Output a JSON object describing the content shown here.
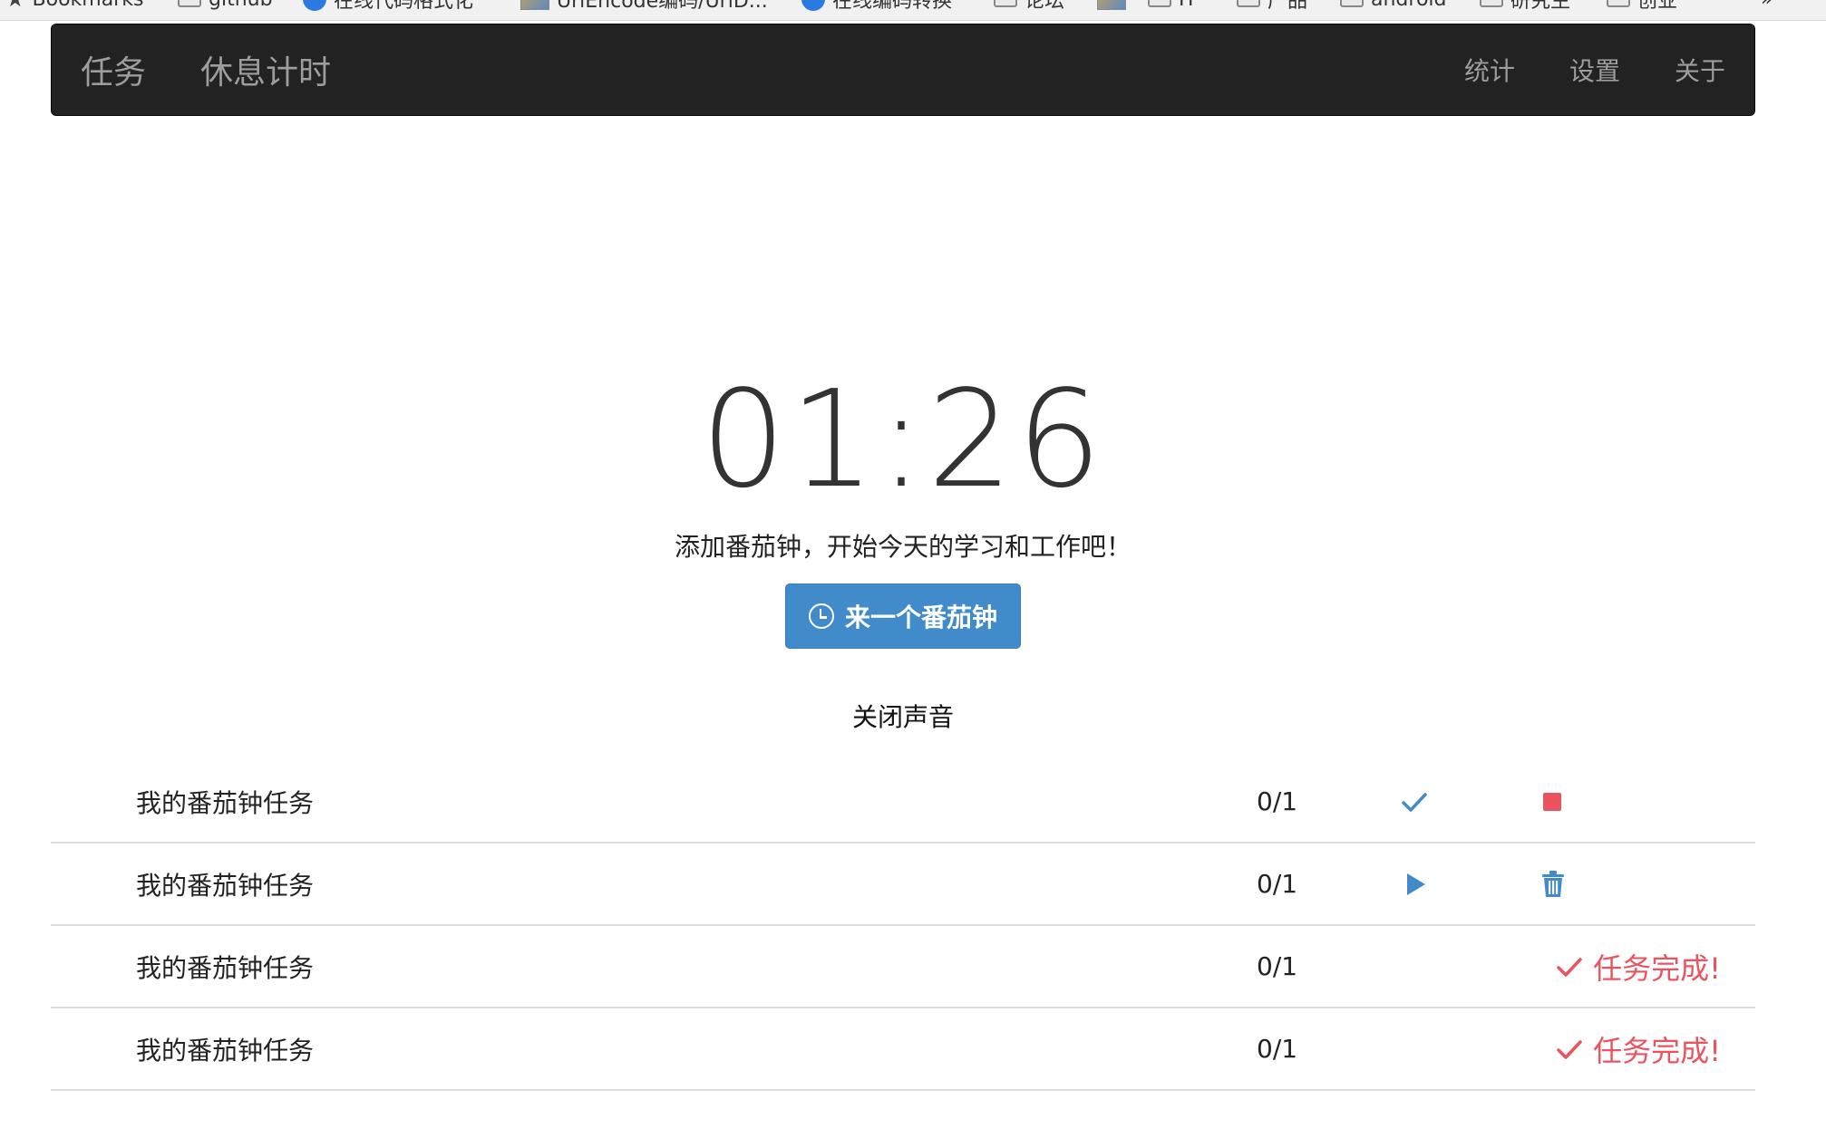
{
  "bookmarks": {
    "items": [
      {
        "label": "Bookmarks",
        "icon": "star-icon"
      },
      {
        "label": "github",
        "icon": "folder-icon"
      },
      {
        "label": "在线代码格式化",
        "icon": "globe-icon"
      },
      {
        "label": "UrlEncode编码/UrlD...",
        "icon": "page-icon"
      },
      {
        "label": "在线编码转换",
        "icon": "globe-icon"
      },
      {
        "label": "论坛",
        "icon": "folder-icon"
      },
      {
        "label": "",
        "icon": "image-icon"
      },
      {
        "label": "IT",
        "icon": "folder-icon"
      },
      {
        "label": "产品",
        "icon": "folder-icon"
      },
      {
        "label": "android",
        "icon": "folder-icon"
      },
      {
        "label": "研究生",
        "icon": "folder-icon"
      },
      {
        "label": "创业",
        "icon": "folder-icon"
      }
    ],
    "overflow": "»"
  },
  "navbar": {
    "left": [
      "任务",
      "休息计时"
    ],
    "right": [
      "统计",
      "设置",
      "关于"
    ]
  },
  "timer": {
    "display": "01:26",
    "hint": "添加番茄钟，开始今天的学习和工作吧！",
    "start_button": "来一个番茄钟",
    "sound_toggle": "关闭声音"
  },
  "tasks": [
    {
      "name": "我的番茄钟任务",
      "count": "0/1",
      "state": "running"
    },
    {
      "name": "我的番茄钟任务",
      "count": "0/1",
      "state": "idle"
    },
    {
      "name": "我的番茄钟任务",
      "count": "0/1",
      "state": "done",
      "done_label": "任务完成!"
    },
    {
      "name": "我的番茄钟任务",
      "count": "0/1",
      "state": "done",
      "done_label": "任务完成!"
    }
  ],
  "colors": {
    "navbar_bg": "#222222",
    "nav_text": "#9d9d9d",
    "primary": "#428bca",
    "danger": "#e9545f",
    "divider": "#dddddd"
  }
}
